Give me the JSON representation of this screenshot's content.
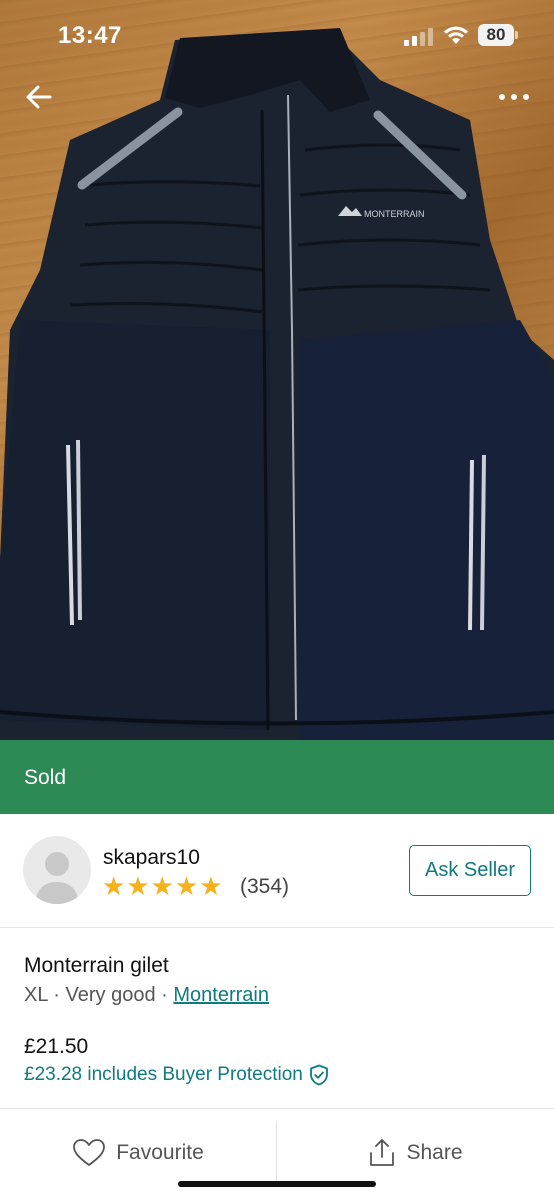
{
  "status_bar": {
    "time": "13:47",
    "battery": "80"
  },
  "photo": {
    "brand_logo": "MONTERRAIN"
  },
  "banner": {
    "status": "Sold",
    "color": "#2e8a55"
  },
  "seller": {
    "username": "skapars10",
    "rating_stars": 5,
    "stars": "★★★★★",
    "review_count": "(354)",
    "ask_label": "Ask Seller"
  },
  "item": {
    "title": "Monterrain gilet",
    "size": "XL",
    "sep1": " · ",
    "condition": "Very good",
    "sep2": " · ",
    "brand": "Monterrain",
    "price": "£21.50",
    "protection_text": "£23.28 includes Buyer Protection"
  },
  "actions": {
    "favourite_label": "Favourite",
    "share_label": "Share"
  },
  "colors": {
    "accent": "#0f7b80",
    "star": "#f5b21b"
  }
}
